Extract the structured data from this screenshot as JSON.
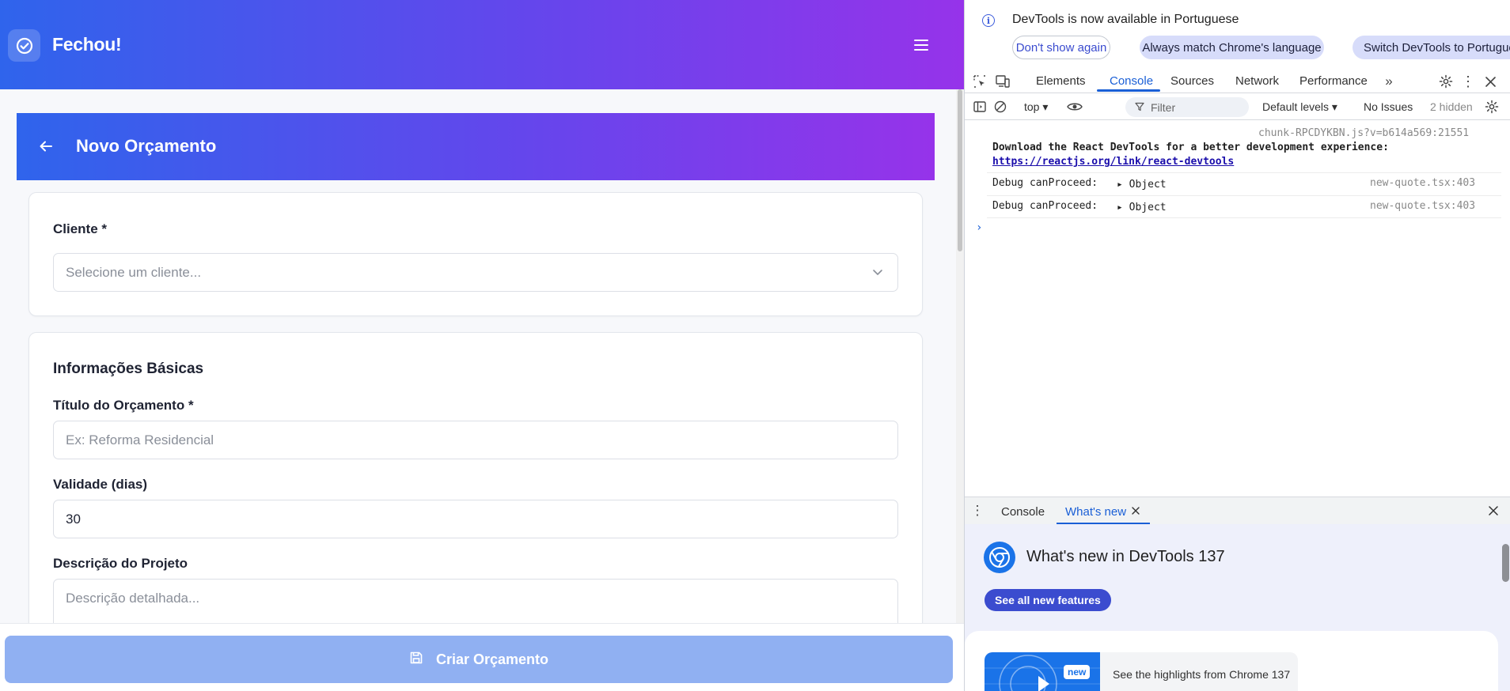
{
  "app": {
    "brand": "Fechou!",
    "page_title": "Novo Orçamento",
    "cliente": {
      "label": "Cliente *",
      "placeholder": "Selecione um cliente..."
    },
    "info": {
      "section_title": "Informações Básicas",
      "titulo_label": "Título do Orçamento *",
      "titulo_placeholder": "Ex: Reforma Residencial",
      "validade_label": "Validade (dias)",
      "validade_value": "30",
      "descricao_label": "Descrição do Projeto",
      "descricao_placeholder": "Descrição detalhada..."
    },
    "submit_label": "Criar Orçamento",
    "colors": {
      "gradient_start": "#2f64ec",
      "gradient_end": "#9633ea",
      "submit_disabled": "#90b0f2"
    }
  },
  "devtools": {
    "infobar": {
      "message": "DevTools is now available in Portuguese",
      "dont_show": "Don't show again",
      "always_match": "Always match Chrome's language",
      "switch": "Switch DevTools to Portuguese"
    },
    "tabs": [
      "Elements",
      "Console",
      "Sources",
      "Network",
      "Performance"
    ],
    "active_tab": "Console",
    "filter_bar": {
      "context": "top",
      "filter_placeholder": "Filter",
      "levels": "Default levels",
      "issues": "No Issues",
      "hidden": "2 hidden"
    },
    "console": {
      "entry1_source": "chunk-RPCDYKBN.js?v=b614a569:21551",
      "entry1_text": "Download the React DevTools for a better development experience:",
      "entry1_link": "https://reactjs.org/link/react-devtools",
      "entry2_text": "Debug canProceed:",
      "entry2_obj": "Object",
      "entry2_source": "new-quote.tsx:403",
      "entry3_text": "Debug canProceed:",
      "entry3_obj": "Object",
      "entry3_source": "new-quote.tsx:403"
    },
    "drawer": {
      "tab_console": "Console",
      "tab_whatsnew": "What's new"
    },
    "whatsnew": {
      "title": "What's new in DevTools 137",
      "button": "See all new features",
      "badge": "new",
      "highlight": "See the highlights from Chrome 137"
    }
  }
}
